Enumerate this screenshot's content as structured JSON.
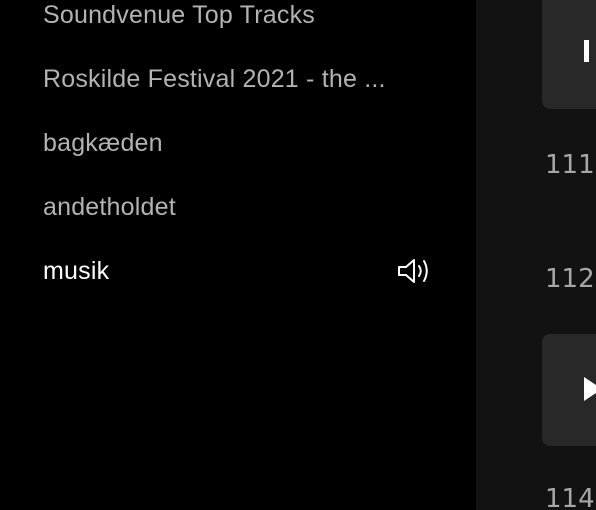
{
  "sidebar": {
    "playlists": [
      {
        "label": "Soundvenue Top Tracks",
        "active": false
      },
      {
        "label": "Roskilde Festival 2021 - the ...",
        "active": false
      },
      {
        "label": "bagkæden",
        "active": false
      },
      {
        "label": "andetholdet",
        "active": false
      },
      {
        "label": "musik",
        "active": true,
        "playing_icon": "speaker-icon"
      }
    ]
  },
  "main": {
    "numbers": [
      "111",
      "112",
      "114"
    ]
  },
  "colors": {
    "sidebar_bg": "#000000",
    "main_bg": "#121212",
    "card_bg": "#282828",
    "text_muted": "#b3b3b3",
    "text_active": "#ffffff"
  }
}
